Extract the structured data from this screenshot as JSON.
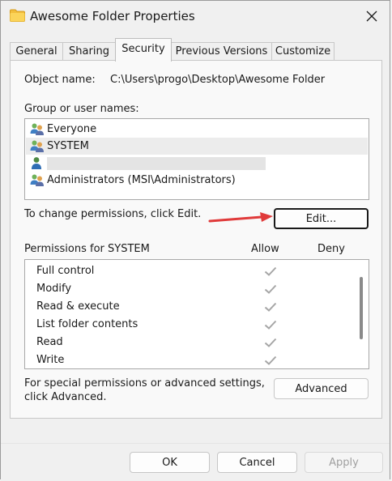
{
  "window": {
    "title": "Awesome Folder Properties"
  },
  "tabs": [
    {
      "label": "General"
    },
    {
      "label": "Sharing"
    },
    {
      "label": "Security"
    },
    {
      "label": "Previous Versions"
    },
    {
      "label": "Customize"
    }
  ],
  "security": {
    "object_name_label": "Object name:",
    "object_name_value": "C:\\Users\\progo\\Desktop\\Awesome Folder",
    "group_label": "Group or user names:",
    "groups": [
      {
        "name": "Everyone"
      },
      {
        "name": "SYSTEM"
      },
      {
        "name": ""
      },
      {
        "name": "Administrators (MSI\\Administrators)"
      }
    ],
    "change_text": "To change permissions, click Edit.",
    "edit_label": "Edit...",
    "perm_label": "Permissions for SYSTEM",
    "allow_label": "Allow",
    "deny_label": "Deny",
    "permissions": [
      {
        "name": "Full control",
        "allow": true,
        "deny": false
      },
      {
        "name": "Modify",
        "allow": true,
        "deny": false
      },
      {
        "name": "Read & execute",
        "allow": true,
        "deny": false
      },
      {
        "name": "List folder contents",
        "allow": true,
        "deny": false
      },
      {
        "name": "Read",
        "allow": true,
        "deny": false
      },
      {
        "name": "Write",
        "allow": true,
        "deny": false
      }
    ],
    "special_text_line1": "For special permissions or advanced settings,",
    "special_text_line2": "click Advanced.",
    "advanced_label": "Advanced"
  },
  "footer": {
    "ok_label": "OK",
    "cancel_label": "Cancel",
    "apply_label": "Apply"
  },
  "colors": {
    "annotation_arrow": "#e03a3a",
    "check_mark": "#a6a6a6"
  },
  "icons": {
    "title": "folder-icon",
    "close": "close-icon",
    "group": "user-group-icon",
    "user": "user-icon",
    "check": "check-icon"
  }
}
